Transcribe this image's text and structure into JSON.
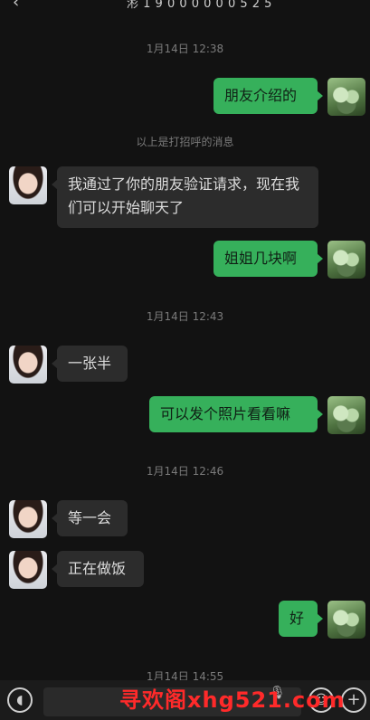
{
  "header": {
    "title": "涁 1 9 0 0 0 0 0 0 5 2 5"
  },
  "messages": {
    "t1": "1月14日 12:38",
    "m1": "朋友介绍的",
    "sys": "以上是打招呼的消息",
    "m2": "我通过了你的朋友验证请求，现在我们可以开始聊天了",
    "m3": "姐姐几块啊",
    "t2": "1月14日 12:43",
    "m4": "一张半",
    "m5": "可以发个照片看看嘛",
    "t3": "1月14日 12:46",
    "m6": "等一会",
    "m7": "正在做饭",
    "m8": "好",
    "t4": "1月14日 14:55"
  },
  "watermark": "寻欢阁xhg521.com",
  "icons": {
    "voice": "voice-icon",
    "mic": "mic-icon",
    "emoji": "emoji-icon",
    "plus": "plus-icon"
  }
}
